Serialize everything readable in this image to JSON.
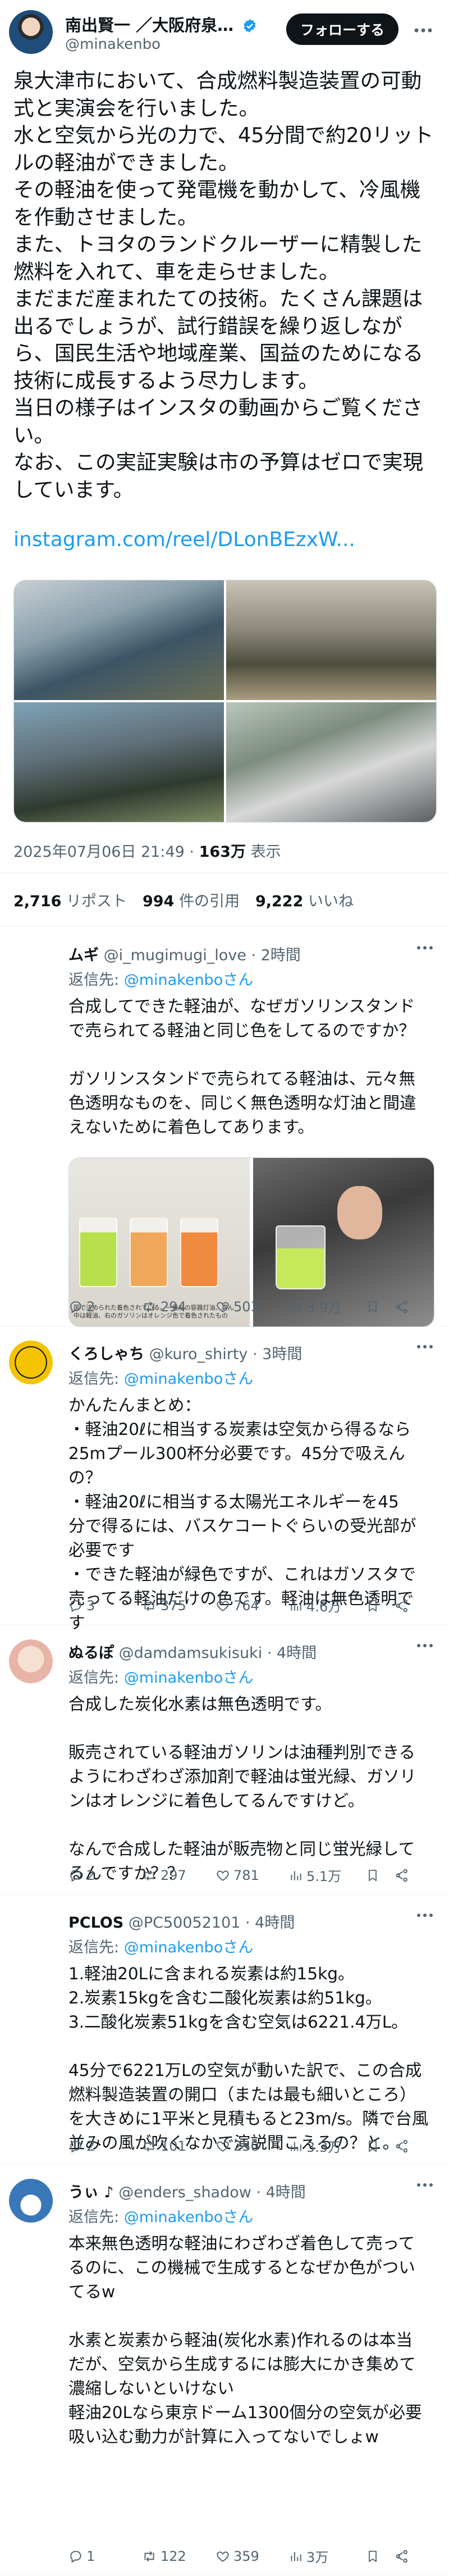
{
  "post": {
    "author_name": "南出賢一 ／大阪府泉…",
    "author_handle": "@minakenbo",
    "follow_label": "フォローする",
    "text": "泉大津市において、合成燃料製造装置の可動\n式と実演会を行いました。\n水と空気から光の力で、45分間で約20リット\nルの軽油ができました。\nその軽油を使って発電機を動かして、冷風機\nを作動させました。\nまた、トヨタのランドクルーザーに精製した\n燃料を入れて、車を走らせました。\nまだまだ産まれたての技術。たくさん課題は\n出るでしょうが、試行錯誤を繰り返しなが\nら、国民生活や地域産業、国益のためになる\n技術に成長するよう尽力します。\n当日の様子はインスタの動画からご覧くださ\nい。\nなお、この実証実験は市の予算はゼロで実現\nしています。",
    "link": "instagram.com/reel/DLonBEzxW...",
    "timestamp": "2025年07月06日 21:49",
    "views_count": "163万",
    "views_label": "表示",
    "reposts_count": "2,716",
    "reposts_label": "リポスト",
    "quotes_count": "994",
    "quotes_label": "件の引用",
    "likes_count": "9,222",
    "likes_label": "いいね"
  },
  "replies": [
    {
      "name": "ムギ",
      "handle": "@i_mugimugi_love",
      "time": "· 2時間",
      "reply_to_label": "返信先:",
      "reply_to": "@minakenboさん",
      "text": "合成してできた軽油が、なぜガソリンスタンド\nで売られてる軽油と同じ色をしてるのですか？\n\nガソリンスタンドで売られてる軽油は、元々無\n色透明なものを、同じく無色透明な灯油と間違\nえないために着色してあります。",
      "image_caption": "国で決められた着色されている。一番左の容器灯油、真ん中は軽油、右のガソリンはオレンジ色で着色されたもの",
      "replies": "2",
      "reposts": "294",
      "likes": "503",
      "views": "3.9万"
    },
    {
      "name": "くろしゃち",
      "handle": "@kuro_shirty",
      "time": "· 3時間",
      "reply_to_label": "返信先:",
      "reply_to": "@minakenboさん",
      "text": "かんたんまとめ：\n・軽油20ℓに相当する炭素は空気から得るなら\n25mプール300杯分必要です。45分で吸えん\nの？\n・軽油20ℓに相当する太陽光エネルギーを45\n分で得るには、バスケコートぐらいの受光部が\n必要です\n・できた軽油が緑色ですが、これはガソスタで\n売ってる軽油だけの色です。軽油は無色透明で\nす",
      "replies": "3",
      "reposts": "375",
      "likes": "764",
      "views": "4.6万"
    },
    {
      "name": "ぬるぽ",
      "handle": "@damdamsukisuki",
      "time": "· 4時間",
      "reply_to_label": "返信先:",
      "reply_to": "@minakenboさん",
      "text": "合成した炭化水素は無色透明です。\n\n販売されている軽油ガソリンは油種判別できる\nようにわざわざ添加剤で軽油は蛍光緑、ガソリ\nンはオレンジに着色してるんですけど。\n\nなんで合成した軽油が販売物と同じ蛍光緑して\nるんですか？？",
      "replies": "2",
      "reposts": "297",
      "likes": "781",
      "views": "5.1万"
    },
    {
      "name": "PCLOS",
      "handle": "@PC50052101",
      "time": "· 4時間",
      "reply_to_label": "返信先:",
      "reply_to": "@minakenboさん",
      "text": "1.軽油20Lに含まれる炭素は約15kg。\n2.炭素15kgを含む二酸化炭素は約51kg。\n3.二酸化炭素51kgを含む空気は6221.4万L。\n\n45分で6221万Lの空気が動いた訳で、この合成\n燃料製造装置の開口（または最も細いところ）\nを大きめに1平米と見積もると23m/s。隣で台風\n並みの風が吹くなかで演説聞こえるの？と。",
      "replies": "2",
      "reposts": "101",
      "likes": "250",
      "views": "3.3万"
    },
    {
      "name": "うぃ ♪",
      "handle": "@enders_shadow",
      "time": "· 4時間",
      "reply_to_label": "返信先:",
      "reply_to": "@minakenboさん",
      "text": "本来無色透明な軽油にわざわざ着色して売って\nるのに、この機械で生成するとなぜか色がつい\nてるw\n\n水素と炭素から軽油(炭化水素)作れるのは本当\nだが、空気から生成するには膨大にかき集めて\n濃縮しないといけない\n軽油20Lなら東京ドーム1300個分の空気が必要\n吸い込む動力が計算に入ってないでしょw",
      "replies": "1",
      "reposts": "122",
      "likes": "359",
      "views": "3万"
    }
  ],
  "colors": {
    "link": "#1d9bf0",
    "muted": "#536471",
    "text": "#0f1419"
  }
}
